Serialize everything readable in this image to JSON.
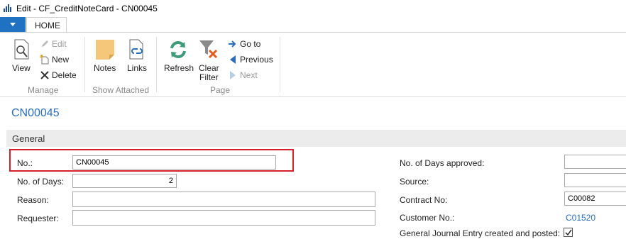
{
  "window": {
    "title": "Edit - CF_CreditNoteCard - CN00045"
  },
  "ribbon": {
    "tabs": [
      "HOME"
    ],
    "groups": {
      "manage": {
        "label": "Manage",
        "view": "View",
        "edit": "Edit",
        "new": "New",
        "delete": "Delete"
      },
      "show_attached": {
        "label": "Show Attached",
        "notes": "Notes",
        "links": "Links"
      },
      "page": {
        "label": "Page",
        "refresh": "Refresh",
        "clear_filter_1": "Clear",
        "clear_filter_2": "Filter",
        "go_to": "Go to",
        "previous": "Previous",
        "next": "Next"
      }
    }
  },
  "page": {
    "title": "CN00045"
  },
  "general": {
    "section_label": "General",
    "left": {
      "no_label": "No.:",
      "no_value": "CN00045",
      "days_label": "No. of Days:",
      "days_value": "2",
      "reason_label": "Reason:",
      "reason_value": "",
      "requester_label": "Requester:",
      "requester_value": ""
    },
    "right": {
      "days_approved_label": "No. of Days approved:",
      "days_approved_value": "",
      "source_label": "Source:",
      "source_value": "",
      "contract_label": "Contract No:",
      "contract_value": "C00082",
      "customer_label": "Customer No.:",
      "customer_value": "C01520",
      "gj_label": "General Journal Entry created and posted:",
      "gj_checked": true
    }
  },
  "colors": {
    "accent": "#1f71c1",
    "link": "#2a6ebb",
    "highlight": "#d7202a"
  },
  "icons": [
    "app-icon",
    "view-icon",
    "edit-icon",
    "new-icon",
    "delete-icon",
    "notes-icon",
    "links-icon",
    "refresh-icon",
    "clear-filter-icon",
    "go-to-icon",
    "previous-icon",
    "next-icon",
    "checkmark-icon"
  ]
}
